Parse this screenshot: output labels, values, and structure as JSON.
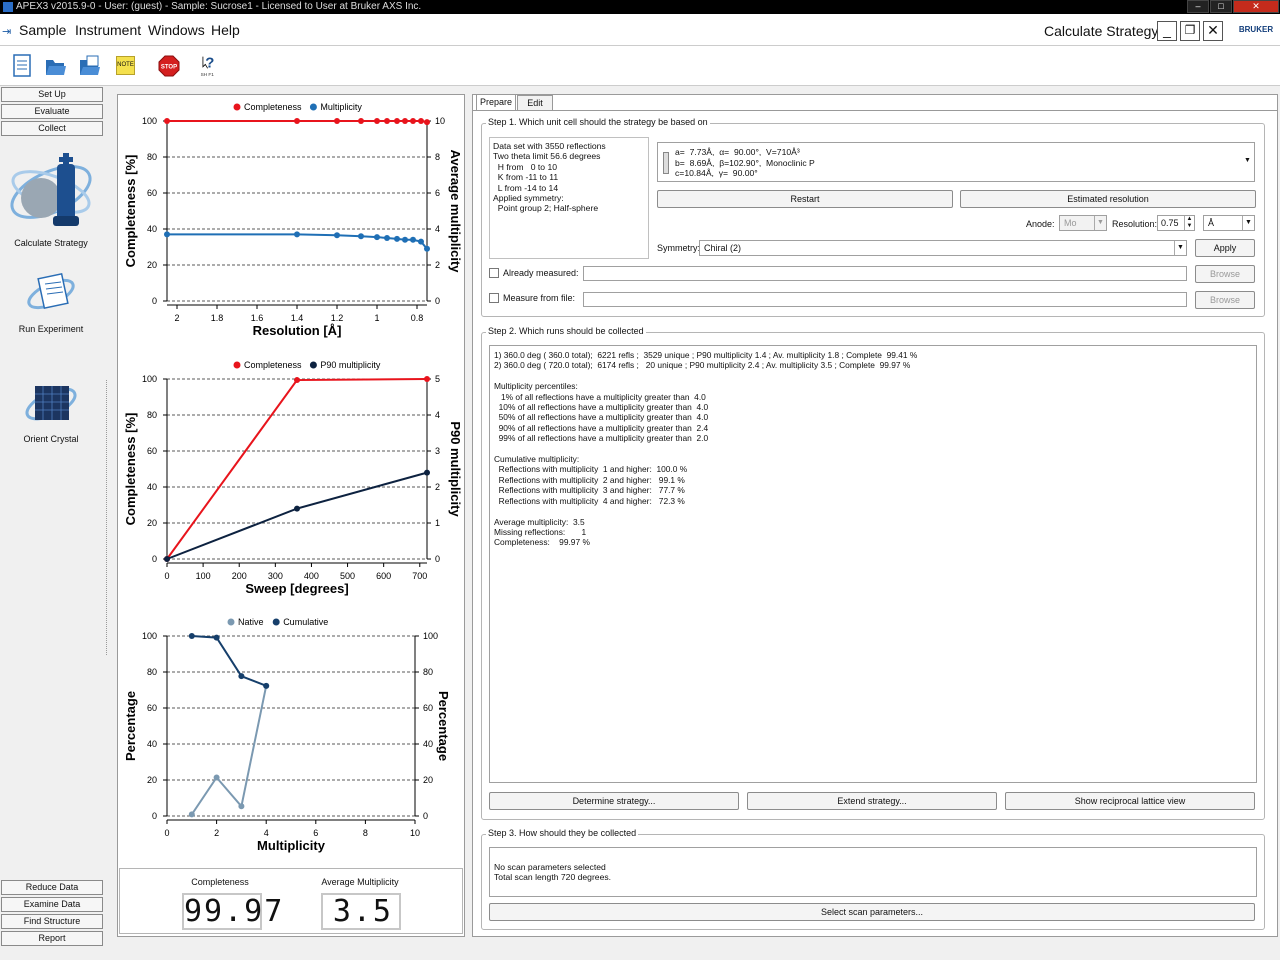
{
  "titlebar": {
    "title": "APEX3 v2015.9-0 - User: (guest) - Sample: Sucrose1 - Licensed to User at Bruker AXS Inc."
  },
  "menu": {
    "items": [
      "Sample",
      "Instrument",
      "Windows",
      "Help"
    ],
    "screen_title": "Calculate Strategy",
    "logo_text": "BRUKER"
  },
  "toolbar": {
    "note_label": "NOTE",
    "stop_label": "STOP",
    "help_label": "SH F1"
  },
  "nav": {
    "top_buttons": [
      "Set Up",
      "Evaluate",
      "Collect"
    ],
    "tiles": [
      "Calculate Strategy",
      "Run Experiment",
      "Orient Crystal"
    ],
    "bottom_buttons": [
      "Reduce Data",
      "Examine Data",
      "Find Structure",
      "Report"
    ]
  },
  "chart_data": [
    {
      "type": "line",
      "legend": [
        "Completeness",
        "Multiplicity"
      ],
      "xlabel": "Resolution [Å]",
      "ylabel": "Completeness [%]",
      "y2label": "Average multiplicity",
      "x_ticks": [
        "2",
        "1.8",
        "1.6",
        "1.4",
        "1.2",
        "1",
        "0.8"
      ],
      "y_ticks": [
        "0",
        "20",
        "40",
        "60",
        "80",
        "100"
      ],
      "y2_ticks": [
        "0",
        "2",
        "4",
        "6",
        "8",
        "10"
      ],
      "xlim": [
        2.05,
        0.75
      ],
      "ylim": [
        0,
        100
      ],
      "y2lim": [
        0,
        10
      ],
      "series": [
        {
          "name": "Completeness",
          "color": "#e8141c",
          "axis": "left",
          "x": [
            2.05,
            1.4,
            1.2,
            1.08,
            1.0,
            0.95,
            0.9,
            0.86,
            0.82,
            0.78,
            0.75
          ],
          "values": [
            100,
            100,
            100,
            100,
            100,
            100,
            100,
            100,
            100,
            100,
            99.4
          ]
        },
        {
          "name": "Multiplicity",
          "color": "#1f6fb5",
          "axis": "right",
          "x": [
            2.05,
            1.4,
            1.2,
            1.08,
            1.0,
            0.95,
            0.9,
            0.86,
            0.82,
            0.78,
            0.75
          ],
          "values": [
            3.7,
            3.7,
            3.65,
            3.6,
            3.55,
            3.5,
            3.45,
            3.4,
            3.4,
            3.3,
            2.9
          ]
        }
      ]
    },
    {
      "type": "line",
      "legend": [
        "Completeness",
        "P90 multiplicity"
      ],
      "xlabel": "Sweep [degrees]",
      "ylabel": "Completeness [%]",
      "y2label": "P90 multiplicity",
      "x_ticks": [
        "0",
        "100",
        "200",
        "300",
        "400",
        "500",
        "600",
        "700"
      ],
      "y_ticks": [
        "0",
        "20",
        "40",
        "60",
        "80",
        "100"
      ],
      "y2_ticks": [
        "0",
        "1",
        "2",
        "3",
        "4",
        "5"
      ],
      "xlim": [
        0,
        720
      ],
      "ylim": [
        0,
        100
      ],
      "y2lim": [
        0,
        5
      ],
      "series": [
        {
          "name": "Completeness",
          "color": "#e8141c",
          "axis": "left",
          "x": [
            0,
            360,
            720
          ],
          "values": [
            0,
            99.41,
            99.97
          ]
        },
        {
          "name": "P90 multiplicity",
          "color": "#0d2240",
          "axis": "right",
          "x": [
            0,
            360,
            720
          ],
          "values": [
            0,
            1.4,
            2.4
          ]
        }
      ]
    },
    {
      "type": "line",
      "legend": [
        "Native",
        "Cumulative"
      ],
      "xlabel": "Multiplicity",
      "ylabel": "Percentage",
      "y2label": "Percentage",
      "x_ticks": [
        "0",
        "2",
        "4",
        "6",
        "8",
        "10"
      ],
      "y_ticks": [
        "0",
        "20",
        "40",
        "60",
        "80",
        "100"
      ],
      "y2_ticks": [
        "0",
        "20",
        "40",
        "60",
        "80",
        "100"
      ],
      "xlim": [
        0,
        10
      ],
      "ylim": [
        0,
        100
      ],
      "y2lim": [
        0,
        100
      ],
      "series": [
        {
          "name": "Native",
          "color": "#7b99b1",
          "axis": "left",
          "x": [
            1,
            2,
            3,
            4
          ],
          "values": [
            0.9,
            21.4,
            5.4,
            72.3
          ]
        },
        {
          "name": "Cumulative",
          "color": "#163f6b",
          "axis": "left",
          "x": [
            1,
            2,
            3,
            4
          ],
          "values": [
            100.0,
            99.1,
            77.7,
            72.3
          ]
        }
      ]
    }
  ],
  "summary": {
    "completeness_label": "Completeness",
    "completeness_value": "99.97",
    "multiplicity_label": "Average Multiplicity",
    "multiplicity_value": "3.5"
  },
  "tabs": [
    "Prepare",
    "Edit"
  ],
  "step1": {
    "title": "Step 1. Which unit cell should the strategy be based on",
    "dataset_info": "Data set with 3550 reflections\nTwo theta limit 56.6 degrees\n  H from   0 to 10\n  K from -11 to 11\n  L from -14 to 14\nApplied symmetry:\n  Point group 2; Half-sphere",
    "cell_text": "a=  7.73Å,  α=  90.00°,  V=710Å³\nb=  8.69Å,  β=102.90°,  Monoclinic P\nc=10.84Å,  γ=  90.00°",
    "restart": "Restart",
    "estimated_resolution": "Estimated resolution",
    "anode_label": "Anode:",
    "anode_value": "Mo",
    "resolution_label": "Resolution:",
    "resolution_value": "0.75",
    "resolution_unit": "Å",
    "symmetry_label": "Symmetry:",
    "symmetry_value": "Chiral (2)",
    "apply": "Apply",
    "already_measured": "Already measured:",
    "measure_from_file": "Measure from file:",
    "browse": "Browse"
  },
  "step2": {
    "title": "Step 2. Which runs should be collected",
    "report": "1) 360.0 deg ( 360.0 total);  6221 refls ;  3529 unique ; P90 multiplicity 1.4 ; Av. multiplicity 1.8 ; Complete  99.41 %\n2) 360.0 deg ( 720.0 total);  6174 refls ;   20 unique ; P90 multiplicity 2.4 ; Av. multiplicity 3.5 ; Complete  99.97 %\n\nMultiplicity percentiles:\n   1% of all reflections have a multiplicity greater than  4.0\n  10% of all reflections have a multiplicity greater than  4.0\n  50% of all reflections have a multiplicity greater than  4.0\n  90% of all reflections have a multiplicity greater than  2.4\n  99% of all reflections have a multiplicity greater than  2.0\n\nCumulative multiplicity:\n  Reflections with multiplicity  1 and higher:  100.0 %\n  Reflections with multiplicity  2 and higher:   99.1 %\n  Reflections with multiplicity  3 and higher:   77.7 %\n  Reflections with multiplicity  4 and higher:   72.3 %\n\nAverage multiplicity:  3.5\nMissing reflections:       1\nCompleteness:    99.97 %",
    "determine": "Determine strategy...",
    "extend": "Extend strategy...",
    "show_lattice": "Show reciprocal lattice view"
  },
  "step3": {
    "title": "Step 3. How should they be collected",
    "text": "No scan parameters selected\nTotal scan length 720 degrees.",
    "select": "Select scan parameters..."
  }
}
